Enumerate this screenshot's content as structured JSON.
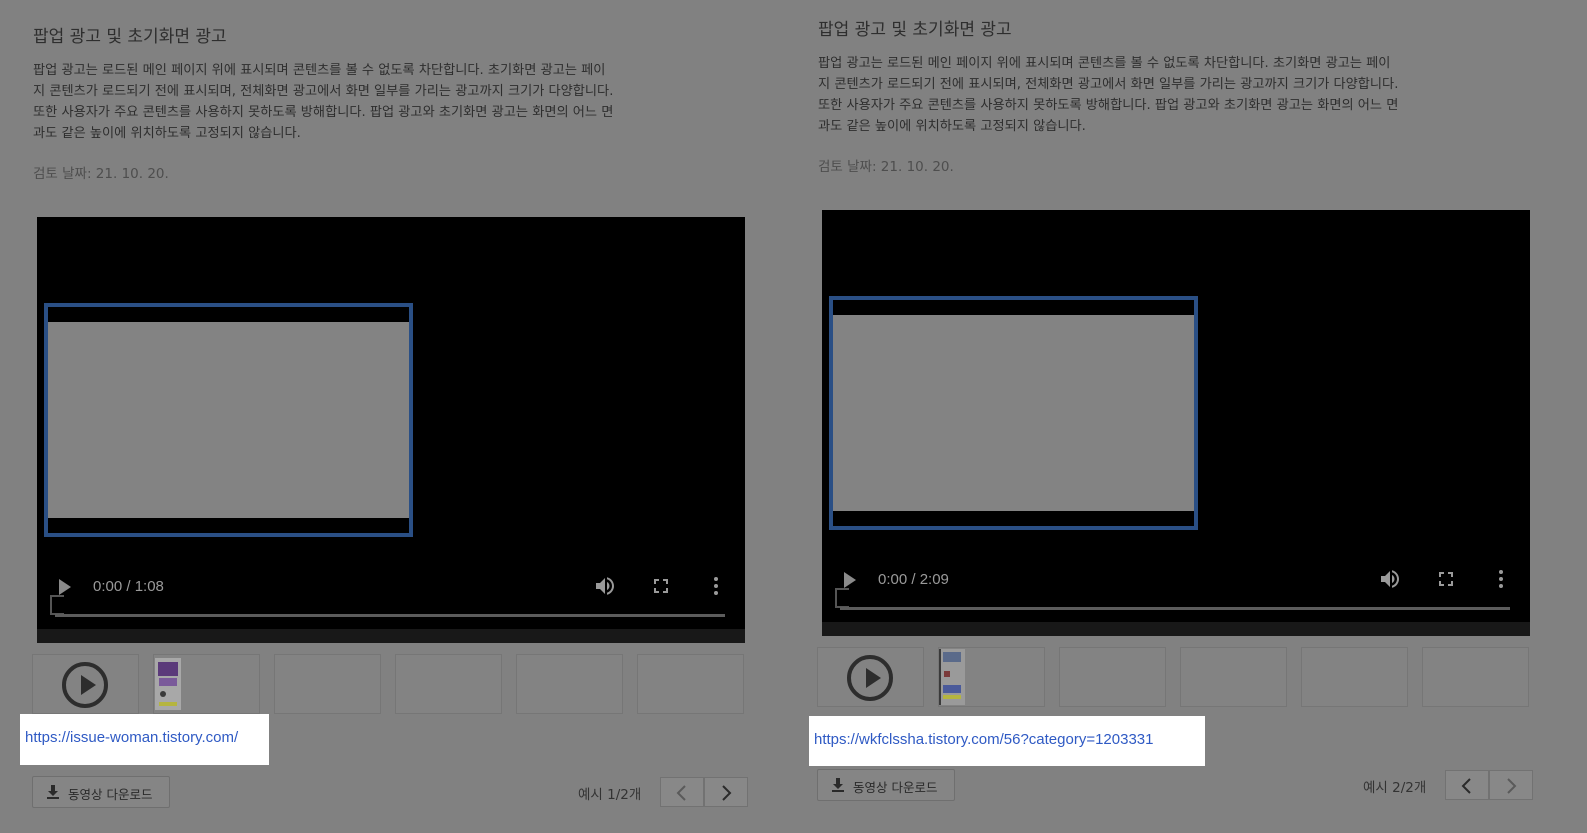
{
  "panels": [
    {
      "title": "팝업 광고 및 초기화면 광고",
      "description": [
        "팝업 광고는 로드된 메인 페이지 위에 표시되며 콘텐츠를 볼 수 없도록 차단합니다. 초기화면 광고는 페이",
        "지 콘텐츠가 로드되기 전에 표시되며, 전체화면 광고에서 화면 일부를 가리는 광고까지 크기가 다양합니다.",
        "또한 사용자가 주요 콘텐츠를 사용하지 못하도록 방해합니다. 팝업 광고와 초기화면 광고는 화면의 어느 면",
        "과도 같은 높이에 위치하도록 고정되지 않습니다."
      ],
      "review_date": "검토 날짜: 21. 10. 20.",
      "video": {
        "time": "0:00 / 1:08"
      },
      "link": "https://issue-woman.tistory.com/",
      "download_label": "동영상 다운로드",
      "counter": "예시 1/2개"
    },
    {
      "title": "팝업 광고 및 초기화면 광고",
      "description": [
        "팝업 광고는 로드된 메인 페이지 위에 표시되며 콘텐츠를 볼 수 없도록 차단합니다. 초기화면 광고는 페이",
        "지 콘텐츠가 로드되기 전에 표시되며, 전체화면 광고에서 화면 일부를 가리는 광고까지 크기가 다양합니다.",
        "또한 사용자가 주요 콘텐츠를 사용하지 못하도록 방해합니다. 팝업 광고와 초기화면 광고는 화면의 어느 면",
        "과도 같은 높이에 위치하도록 고정되지 않습니다."
      ],
      "review_date": "검토 날짜: 21. 10. 20.",
      "video": {
        "time": "0:00 / 2:09"
      },
      "link": "https://wkfclssha.tistory.com/56?category=1203331",
      "download_label": "동영상 다운로드",
      "counter": "예시 2/2개"
    }
  ],
  "icons": {
    "play": "play-icon",
    "volume": "volume-icon",
    "fullscreen": "fullscreen-icon",
    "more": "more-vert-icon",
    "download": "download-icon",
    "prev": "chevron-left-icon",
    "next": "chevron-right-icon"
  },
  "colors": {
    "overlay_background": "#818181",
    "video_background": "#000000",
    "ad_frame": "#2a4f85",
    "link": "#2f5ac4",
    "link_highlight": "#ffffff"
  }
}
